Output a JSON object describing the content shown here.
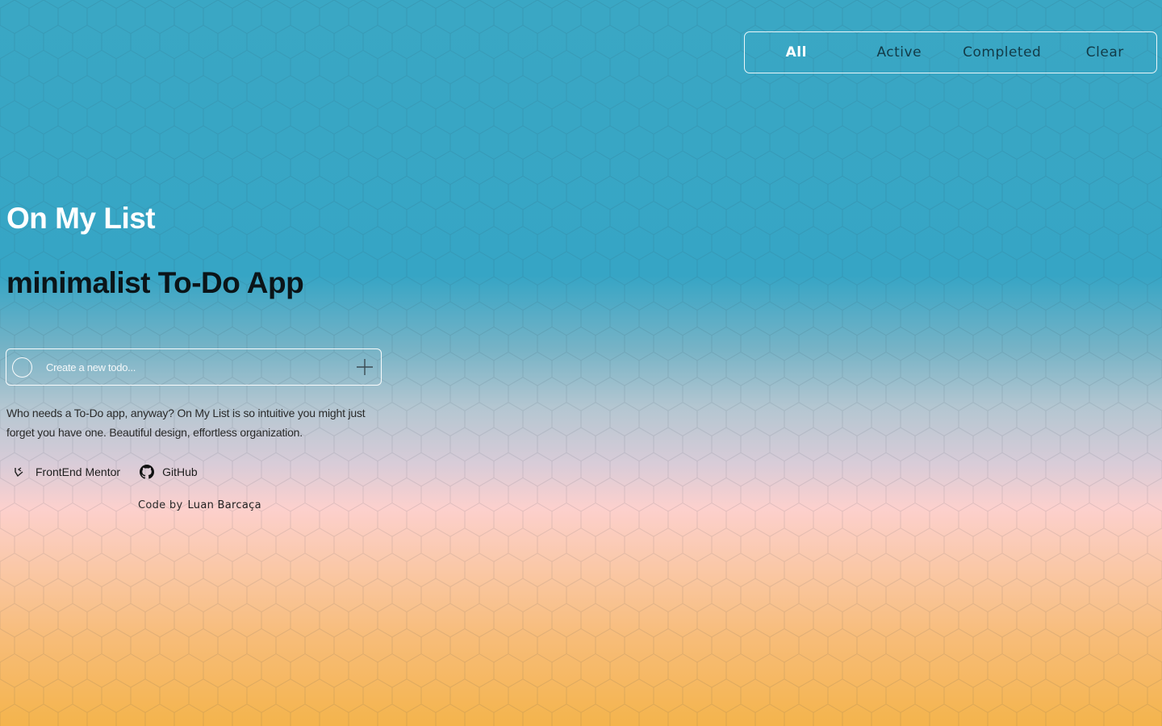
{
  "filters": {
    "all_label": "All",
    "active_label": "Active",
    "completed_label": "Completed",
    "clear_label": "Clear",
    "selected": "All"
  },
  "hero": {
    "title": "On My List",
    "subtitle": "minimalist To-Do App"
  },
  "todo_input": {
    "placeholder": "Create a new todo...",
    "value": "",
    "icons": [
      "checkbox-circle-icon",
      "plus-icon"
    ]
  },
  "description": "Who needs a To-Do app, anyway? On My List is so intuitive you might just forget you have one. Beautiful design, effortless organization.",
  "links": {
    "frontend_mentor_label": "FrontEnd Mentor",
    "github_label": "GitHub",
    "icons": [
      "frontend-mentor-icon",
      "github-icon"
    ]
  },
  "credit": {
    "prefix": "Code by",
    "author": "Luan Barcaça"
  },
  "colors": {
    "gradient_top": "#36a5c5",
    "gradient_mid": "#fcd0cd",
    "gradient_bottom": "#f4b44c",
    "title_color": "#ffffff",
    "subtitle_color": "#0b1418"
  }
}
